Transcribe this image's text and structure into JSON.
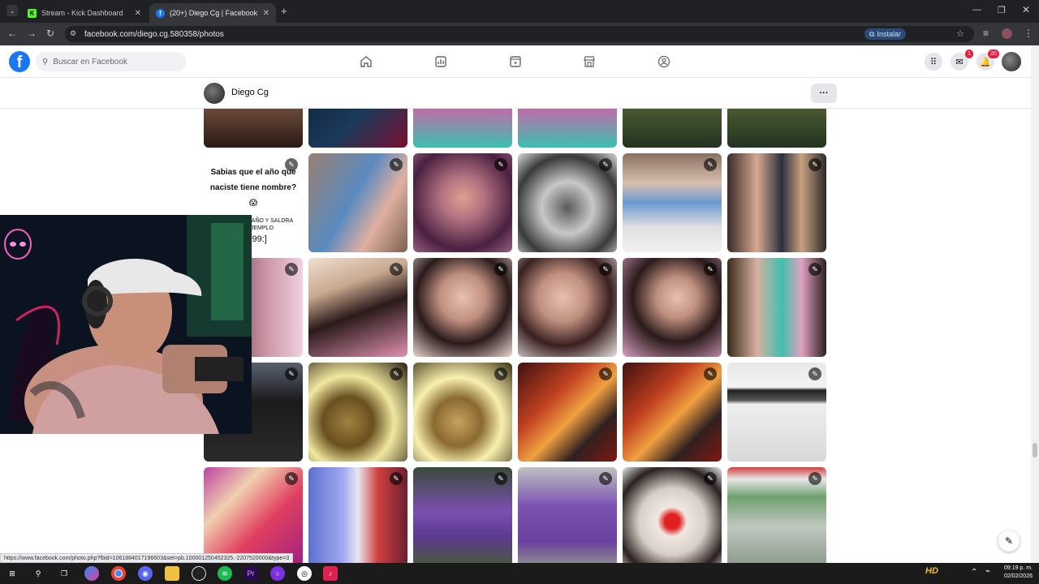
{
  "browser": {
    "tabs": [
      {
        "title": "Stream - Kick Dashboard",
        "favicon": "K",
        "color": "#53fc18"
      },
      {
        "title": "(20+) Diego Cg | Facebook",
        "favicon": "f",
        "color": "#1877f2"
      }
    ],
    "url": "facebook.com/diego.cg.580358/photos",
    "install_label": "Instalar"
  },
  "facebook": {
    "search_placeholder": "Buscar en Facebook",
    "messenger_badge": "1",
    "notifications_badge": "20",
    "profile_name": "Diego Cg",
    "more_label": "···"
  },
  "photos": {
    "text_card_title": "Sabias que el año que naciste tiene nombre?",
    "text_card_emoji": "😱",
    "text_card_small": "COMENTA TU AÑO Y SALDRA",
    "text_card_small2": "POR EJEMPLO",
    "text_card_year": "[1999:]"
  },
  "status_url": "https://www.facebook.com/photo.php?fbid=1061884017196603&set=pb.100001250452325.-2207520000&type=3",
  "taskbar": {
    "time": "09:19 p. m.",
    "date": "02/02/2026"
  }
}
